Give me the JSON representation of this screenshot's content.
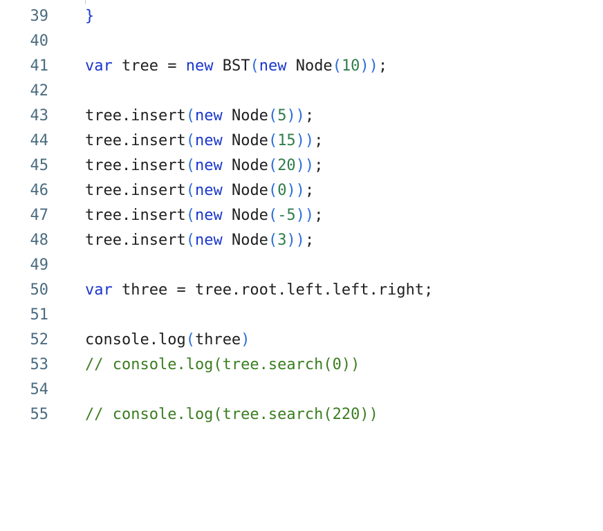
{
  "editor": {
    "lines": [
      {
        "n": "39",
        "tokens": [
          {
            "t": "}",
            "c": "kw"
          }
        ]
      },
      {
        "n": "40",
        "tokens": []
      },
      {
        "n": "41",
        "tokens": [
          {
            "t": "var",
            "c": "kw"
          },
          {
            "t": " tree = ",
            "c": "plain"
          },
          {
            "t": "new",
            "c": "kw"
          },
          {
            "t": " BST",
            "c": "plain"
          },
          {
            "t": "(",
            "c": "paren"
          },
          {
            "t": "new",
            "c": "kw"
          },
          {
            "t": " Node",
            "c": "plain"
          },
          {
            "t": "(",
            "c": "paren"
          },
          {
            "t": "10",
            "c": "num"
          },
          {
            "t": "))",
            "c": "paren"
          },
          {
            "t": ";",
            "c": "plain"
          }
        ]
      },
      {
        "n": "42",
        "tokens": []
      },
      {
        "n": "43",
        "tokens": [
          {
            "t": "tree.insert",
            "c": "plain"
          },
          {
            "t": "(",
            "c": "paren"
          },
          {
            "t": "new",
            "c": "kw"
          },
          {
            "t": " Node",
            "c": "plain"
          },
          {
            "t": "(",
            "c": "paren"
          },
          {
            "t": "5",
            "c": "num"
          },
          {
            "t": "))",
            "c": "paren"
          },
          {
            "t": ";",
            "c": "plain"
          }
        ]
      },
      {
        "n": "44",
        "tokens": [
          {
            "t": "tree.insert",
            "c": "plain"
          },
          {
            "t": "(",
            "c": "paren"
          },
          {
            "t": "new",
            "c": "kw"
          },
          {
            "t": " Node",
            "c": "plain"
          },
          {
            "t": "(",
            "c": "paren"
          },
          {
            "t": "15",
            "c": "num"
          },
          {
            "t": "))",
            "c": "paren"
          },
          {
            "t": ";",
            "c": "plain"
          }
        ]
      },
      {
        "n": "45",
        "tokens": [
          {
            "t": "tree.insert",
            "c": "plain"
          },
          {
            "t": "(",
            "c": "paren"
          },
          {
            "t": "new",
            "c": "kw"
          },
          {
            "t": " Node",
            "c": "plain"
          },
          {
            "t": "(",
            "c": "paren"
          },
          {
            "t": "20",
            "c": "num"
          },
          {
            "t": "))",
            "c": "paren"
          },
          {
            "t": ";",
            "c": "plain"
          }
        ]
      },
      {
        "n": "46",
        "tokens": [
          {
            "t": "tree.insert",
            "c": "plain"
          },
          {
            "t": "(",
            "c": "paren"
          },
          {
            "t": "new",
            "c": "kw"
          },
          {
            "t": " Node",
            "c": "plain"
          },
          {
            "t": "(",
            "c": "paren"
          },
          {
            "t": "0",
            "c": "num"
          },
          {
            "t": "))",
            "c": "paren"
          },
          {
            "t": ";",
            "c": "plain"
          }
        ]
      },
      {
        "n": "47",
        "tokens": [
          {
            "t": "tree.insert",
            "c": "plain"
          },
          {
            "t": "(",
            "c": "paren"
          },
          {
            "t": "new",
            "c": "kw"
          },
          {
            "t": " Node",
            "c": "plain"
          },
          {
            "t": "(",
            "c": "paren"
          },
          {
            "t": "-5",
            "c": "num"
          },
          {
            "t": "))",
            "c": "paren"
          },
          {
            "t": ";",
            "c": "plain"
          }
        ]
      },
      {
        "n": "48",
        "tokens": [
          {
            "t": "tree.insert",
            "c": "plain"
          },
          {
            "t": "(",
            "c": "paren"
          },
          {
            "t": "new",
            "c": "kw"
          },
          {
            "t": " Node",
            "c": "plain"
          },
          {
            "t": "(",
            "c": "paren"
          },
          {
            "t": "3",
            "c": "num"
          },
          {
            "t": "))",
            "c": "paren"
          },
          {
            "t": ";",
            "c": "plain"
          }
        ]
      },
      {
        "n": "49",
        "tokens": []
      },
      {
        "n": "50",
        "tokens": [
          {
            "t": "var",
            "c": "kw"
          },
          {
            "t": " three = tree.root.left.left.right;",
            "c": "plain"
          }
        ]
      },
      {
        "n": "51",
        "tokens": []
      },
      {
        "n": "52",
        "tokens": [
          {
            "t": "console.log",
            "c": "plain"
          },
          {
            "t": "(",
            "c": "paren"
          },
          {
            "t": "three",
            "c": "plain"
          },
          {
            "t": ")",
            "c": "paren"
          }
        ]
      },
      {
        "n": "53",
        "tokens": [
          {
            "t": "// console.log(tree.search(0))",
            "c": "cm"
          }
        ]
      },
      {
        "n": "54",
        "tokens": []
      },
      {
        "n": "55",
        "tokens": [
          {
            "t": "// console.log(tree.search(220))",
            "c": "cm"
          }
        ]
      }
    ]
  },
  "colors": {
    "keyword": "#1a36cc",
    "number": "#2f7c4a",
    "paren": "#2a6bd8",
    "comment": "#3b7d20",
    "text": "#1f1f1f",
    "gutter": "#4a6b80"
  }
}
